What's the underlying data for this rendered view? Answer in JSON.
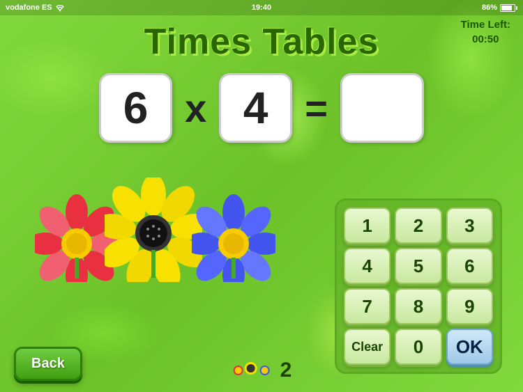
{
  "statusBar": {
    "carrier": "vodafone ES",
    "time": "19:40",
    "battery": "86%",
    "batteryLevel": 86
  },
  "title": "Times Tables",
  "timeLeft": {
    "label": "Time Left:",
    "value": "00:50"
  },
  "equation": {
    "num1": "6",
    "operator": "x",
    "num2": "4",
    "equals": "=",
    "answer": ""
  },
  "keypad": {
    "buttons": [
      "1",
      "2",
      "3",
      "4",
      "5",
      "6",
      "7",
      "8",
      "9",
      "Clear",
      "0",
      "OK"
    ]
  },
  "backButton": "Back",
  "score": "2"
}
